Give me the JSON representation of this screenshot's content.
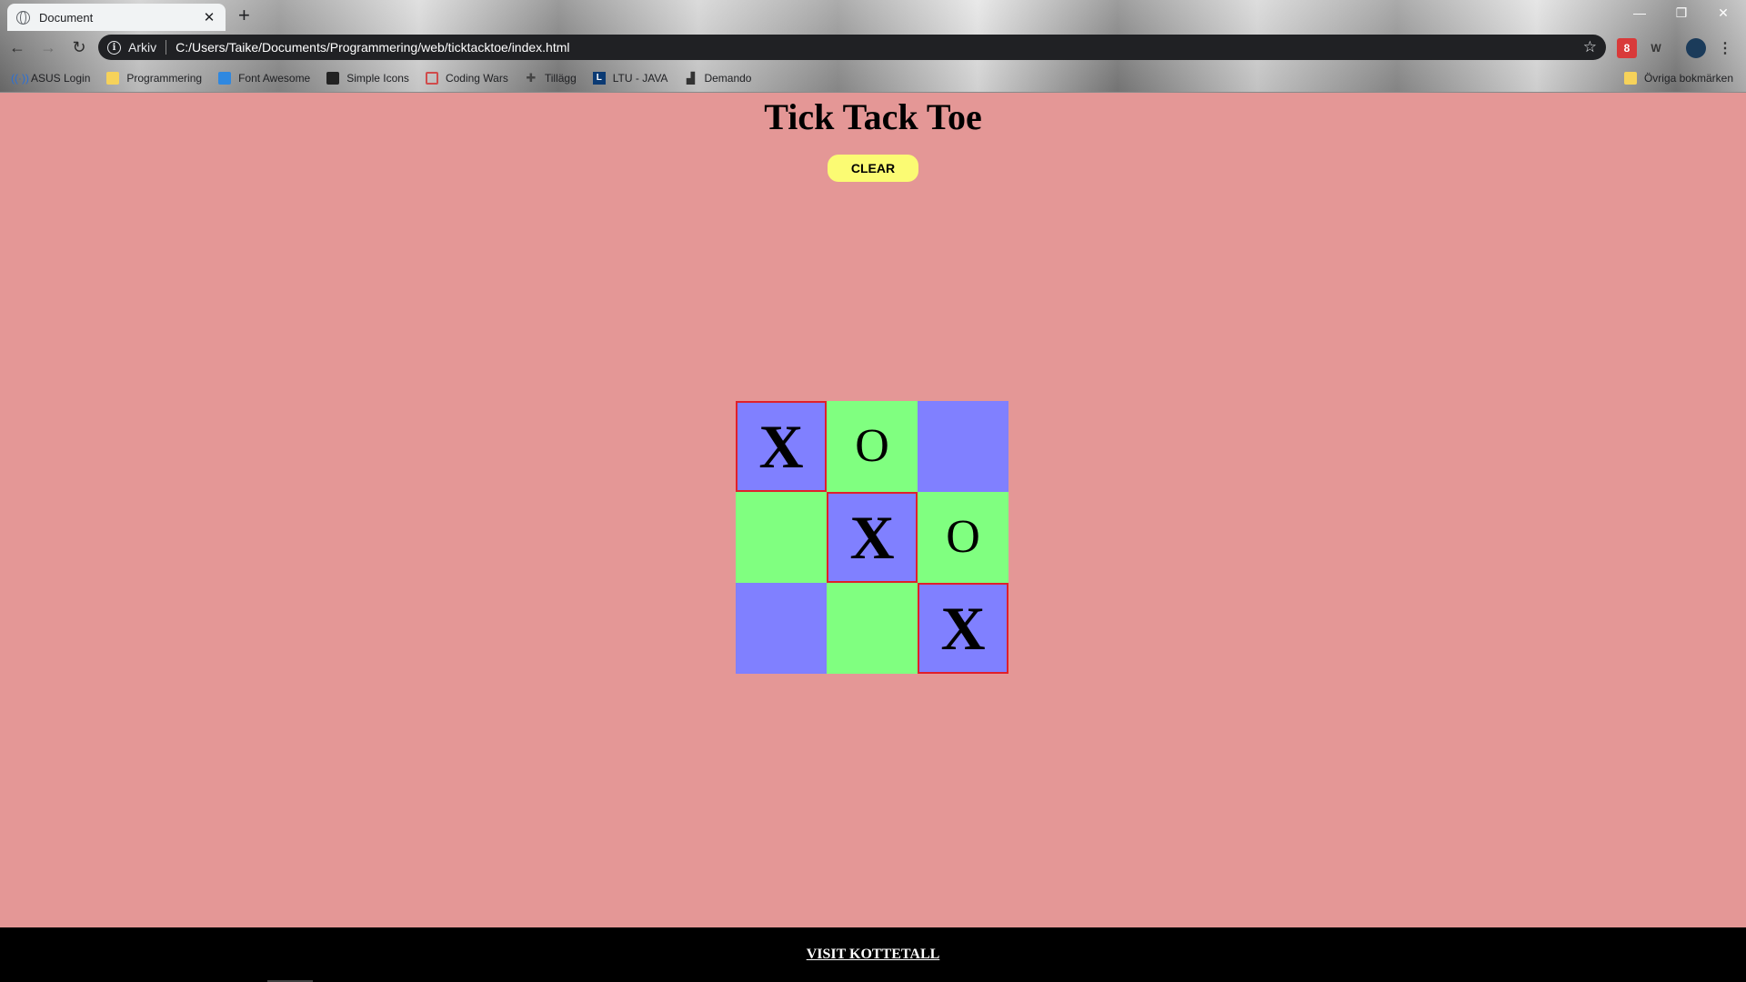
{
  "browser": {
    "tab_title": "Document",
    "address_label": "Arkiv",
    "url": "C:/Users/Taike/Documents/Programmering/web/ticktacktoe/index.html",
    "extension_badge": "8",
    "bookmarks": [
      {
        "label": "ASUS Login",
        "icon": "asus-icon"
      },
      {
        "label": "Programmering",
        "icon": "folder-icon"
      },
      {
        "label": "Font Awesome",
        "icon": "flag-icon"
      },
      {
        "label": "Simple Icons",
        "icon": "simple-icons-icon"
      },
      {
        "label": "Coding Wars",
        "icon": "coding-wars-icon"
      },
      {
        "label": "Tillägg",
        "icon": "puzzle-icon"
      },
      {
        "label": "LTU - JAVA",
        "icon": "ltu-icon"
      },
      {
        "label": "Demando",
        "icon": "chart-icon"
      }
    ],
    "other_bookmarks": "Övriga bokmärken"
  },
  "page": {
    "title": "Tick Tack Toe",
    "clear_label": "CLEAR",
    "board": [
      {
        "mark": "X",
        "color": "#8080ff",
        "highlight": true
      },
      {
        "mark": "O",
        "color": "#80ff80",
        "highlight": false
      },
      {
        "mark": "",
        "color": "#8080ff",
        "highlight": false
      },
      {
        "mark": "",
        "color": "#80ff80",
        "highlight": false
      },
      {
        "mark": "X",
        "color": "#8080ff",
        "highlight": true
      },
      {
        "mark": "O",
        "color": "#80ff80",
        "highlight": false
      },
      {
        "mark": "",
        "color": "#8080ff",
        "highlight": false
      },
      {
        "mark": "",
        "color": "#80ff80",
        "highlight": false
      },
      {
        "mark": "X",
        "color": "#8080ff",
        "highlight": true
      }
    ],
    "footer_link": "VISIT KOTTETALL"
  },
  "colors": {
    "background": "#e49796",
    "button": "#fbfb73",
    "win_border": "#e0202a",
    "footer": "#000000"
  }
}
